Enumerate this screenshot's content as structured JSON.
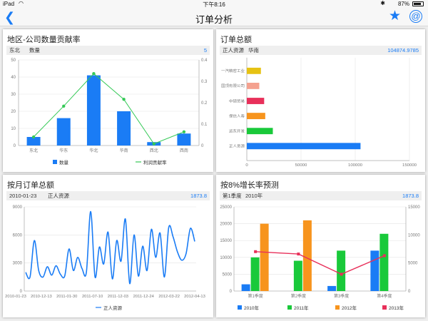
{
  "status_bar": {
    "carrier": "iPad",
    "time": "下午8:16",
    "battery_text": "87%",
    "battery_level": 0.87
  },
  "nav": {
    "title": "订单分析",
    "back_icon": "chevron-left-icon",
    "star_icon": "star-icon",
    "at_icon": "at-icon"
  },
  "colors": {
    "blue": "#1a7cf5",
    "green": "#19c93a",
    "orange": "#f7941d",
    "red": "#e8305a",
    "line_green": "#35c957"
  },
  "cards": {
    "region": {
      "title": "地区-公司数量贡献率",
      "info_left": "东北",
      "info_mid": "数量",
      "info_value": "5"
    },
    "total": {
      "title": "订单总额",
      "info_left": "正人资源",
      "info_mid": "华南",
      "info_value": "104874.9785"
    },
    "monthly": {
      "title": "按月订单总额",
      "info_left": "2010-01-23",
      "info_mid": "正人资源",
      "info_value": "1873.8"
    },
    "growth": {
      "title": "按8%增长率预测",
      "info_left": "第1季度",
      "info_mid": "2010年",
      "info_value": "1873.8"
    }
  },
  "chart_data": [
    {
      "type": "bar",
      "categories": [
        "东北",
        "华东",
        "华北",
        "华南",
        "西北",
        "西南"
      ],
      "series": [
        {
          "name": "数量",
          "type": "bar",
          "values": [
            5,
            16,
            41,
            20,
            2,
            7
          ],
          "color": "#1a7cf5"
        },
        {
          "name": "利润贡献率",
          "type": "line",
          "values": [
            5,
            23,
            42,
            27,
            1,
            8
          ],
          "color": "#35c957"
        }
      ],
      "ylim": [
        0,
        50
      ],
      "y2lim": [
        0,
        0.4
      ],
      "yticks": [
        "0",
        "10",
        "20",
        "30",
        "40",
        "50"
      ],
      "y2ticks": [
        "0",
        "0.1",
        "0.2",
        "0.3",
        "0.4"
      ],
      "grid": true,
      "legend": "bottom"
    },
    {
      "type": "bar",
      "orientation": "horizontal",
      "categories": [
        "一汽精密工业",
        "国顶有限公司",
        "中硕贸易",
        "保信人寿",
        "远东开发",
        "正人资源"
      ],
      "values": [
        13000,
        11500,
        16000,
        17000,
        24000,
        104875
      ],
      "colors": [
        "#e6c213",
        "#f4a18f",
        "#e8305a",
        "#f7941d",
        "#19c93a",
        "#1a7cf5"
      ],
      "xlim": [
        0,
        150000
      ],
      "xticks": [
        "0",
        "50000",
        "100000",
        "150000"
      ],
      "grid": true
    },
    {
      "type": "line",
      "x": [
        "2010-01-23",
        "2010-12-13",
        "2011-01-30",
        "2011-07-10",
        "2011-12-03",
        "2011-12-24",
        "2012-03-22",
        "2012-04-13"
      ],
      "series": [
        {
          "name": "正人资源",
          "values": [
            2000,
            1500,
            5400,
            2200,
            1500,
            2600,
            1700,
            2700,
            1800,
            1600,
            4500,
            2200,
            3600,
            2400,
            2000,
            8500,
            1500,
            4700,
            2900,
            6300,
            1300,
            5400,
            3200,
            7700,
            800,
            6000,
            1600,
            4800,
            2200,
            6600,
            3600,
            6200,
            1500,
            6800,
            5800,
            4200,
            3300,
            4000,
            6700,
            5300
          ],
          "color": "#1a7cf5"
        }
      ],
      "ylim": [
        0,
        9000
      ],
      "yticks": [
        "0",
        "3000",
        "6000",
        "9000"
      ],
      "grid": true,
      "legend": "bottom"
    },
    {
      "type": "bar",
      "categories": [
        "第1季度",
        "第2季度",
        "第3季度",
        "第4季度"
      ],
      "series": [
        {
          "name": "2010年",
          "type": "bar",
          "values": [
            2000,
            0,
            1500,
            12000
          ],
          "color": "#1a7cf5"
        },
        {
          "name": "2011年",
          "type": "bar",
          "values": [
            10000,
            9000,
            12000,
            17000
          ],
          "color": "#19c93a"
        },
        {
          "name": "2012年",
          "type": "bar",
          "values": [
            20000,
            21000,
            0,
            0
          ],
          "color": "#f7941d"
        },
        {
          "name": "2013年",
          "type": "line",
          "values": [
            11700,
            11000,
            5000,
            10500
          ],
          "color": "#e8305a"
        }
      ],
      "ylim": [
        0,
        25000
      ],
      "yticks": [
        "0",
        "5000",
        "10000",
        "15000",
        "20000",
        "25000"
      ],
      "y2lim": [
        0,
        15000
      ],
      "y2ticks": [
        "0",
        "5000",
        "10000",
        "15000"
      ],
      "grid": true,
      "legend": "bottom"
    }
  ]
}
